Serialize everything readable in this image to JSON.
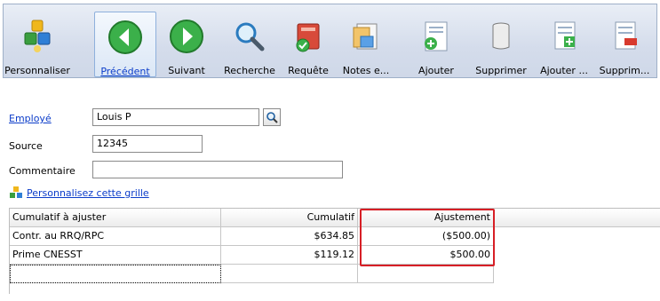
{
  "toolbar": {
    "buttons": [
      {
        "label": "Personnaliser",
        "icon": "blocks-icon"
      },
      {
        "label": "Précédent",
        "icon": "previous-arrow-icon",
        "active": true
      },
      {
        "label": "Suivant",
        "icon": "next-arrow-icon"
      },
      {
        "label": "Recherche",
        "icon": "magnifier-icon"
      },
      {
        "label": "Requête",
        "icon": "query-icon"
      },
      {
        "label": "Notes e...",
        "icon": "notes-icon"
      },
      {
        "label": "Ajouter",
        "icon": "add-document-icon"
      },
      {
        "label": "Supprimer",
        "icon": "delete-cylinder-icon"
      },
      {
        "label": "Ajouter ...",
        "icon": "add-row-icon"
      },
      {
        "label": "Supprim...",
        "icon": "remove-row-icon"
      }
    ]
  },
  "form": {
    "employee_label": "Employé",
    "employee_value": "Louis P",
    "source_label": "Source",
    "source_value": "12345",
    "comment_label": "Commentaire",
    "comment_value": ""
  },
  "grid_link": "Personnalisez cette grille",
  "grid": {
    "columns": [
      "Cumulatif à ajuster",
      "Cumulatif",
      "Ajustement"
    ],
    "rows": [
      [
        "Contr. au RRQ/RPC",
        "$634.85",
        "($500.00)"
      ],
      [
        "Prime CNESST",
        "$119.12",
        "$500.00"
      ]
    ]
  },
  "colors": {
    "accent_link": "#0b3cc9",
    "highlight": "#d71f26",
    "toolbar_bg": "#d4dceb"
  }
}
